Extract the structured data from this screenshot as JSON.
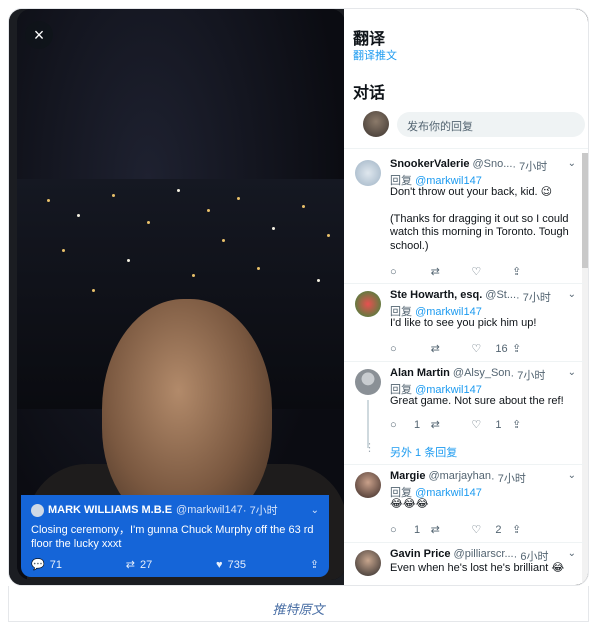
{
  "close_icon": "×",
  "embed": {
    "name": "MARK WILLIAMS M.B.E",
    "handle": "@markwil147",
    "time": " · 7小时",
    "text": "Closing ceremony，I'm gunna Chuck Murphy off the 63 rd floor the lucky xxxt",
    "reply_count": "71",
    "retweet_count": "27",
    "like_count": "735"
  },
  "panel": {
    "translate_title": "翻译",
    "translate_link": "翻译推文",
    "conversation_title": "对话",
    "reply_placeholder": "发布你的回复"
  },
  "replies": [
    {
      "name": "SnookerValerie",
      "handle": "@Sno...",
      "time": " · 7小时",
      "reply_label": "回复 ",
      "reply_to": "@markwil147",
      "text": "Don't throw out your back, kid. 😉",
      "text2": "(Thanks for dragging it out so I could watch this morning in Toronto. Tough school.)",
      "replies": "",
      "retweets": "",
      "likes": ""
    },
    {
      "name": "Ste Howarth, esq.",
      "handle": "@St...",
      "time": " · 7小时",
      "reply_label": "回复 ",
      "reply_to": "@markwil147",
      "text": "I'd like to see you pick him up!",
      "replies": "",
      "retweets": "",
      "likes": "16"
    },
    {
      "name": "Alan Martin",
      "handle": "@Alsy_Son",
      "time": " · 7小时",
      "reply_label": "回复 ",
      "reply_to": "@markwil147",
      "text": "Great game. Not sure about the ref!",
      "replies": "1",
      "retweets": "",
      "likes": "1",
      "more": "另外 1 条回复"
    },
    {
      "name": "Margie",
      "handle": "@marjayhan",
      "time": " · 7小时",
      "reply_label": "回复 ",
      "reply_to": "@markwil147",
      "text": "😂😂😂",
      "replies": "1",
      "retweets": "",
      "likes": "2"
    },
    {
      "name": "Gavin Price",
      "handle": "@pilliarscr...",
      "time": " · 6小时",
      "text": "Even when he's lost he's brilliant 😂"
    }
  ],
  "caption": "推特原文",
  "colors": {
    "accent": "#1d9bf0",
    "embed_bg": "#1565d8"
  }
}
